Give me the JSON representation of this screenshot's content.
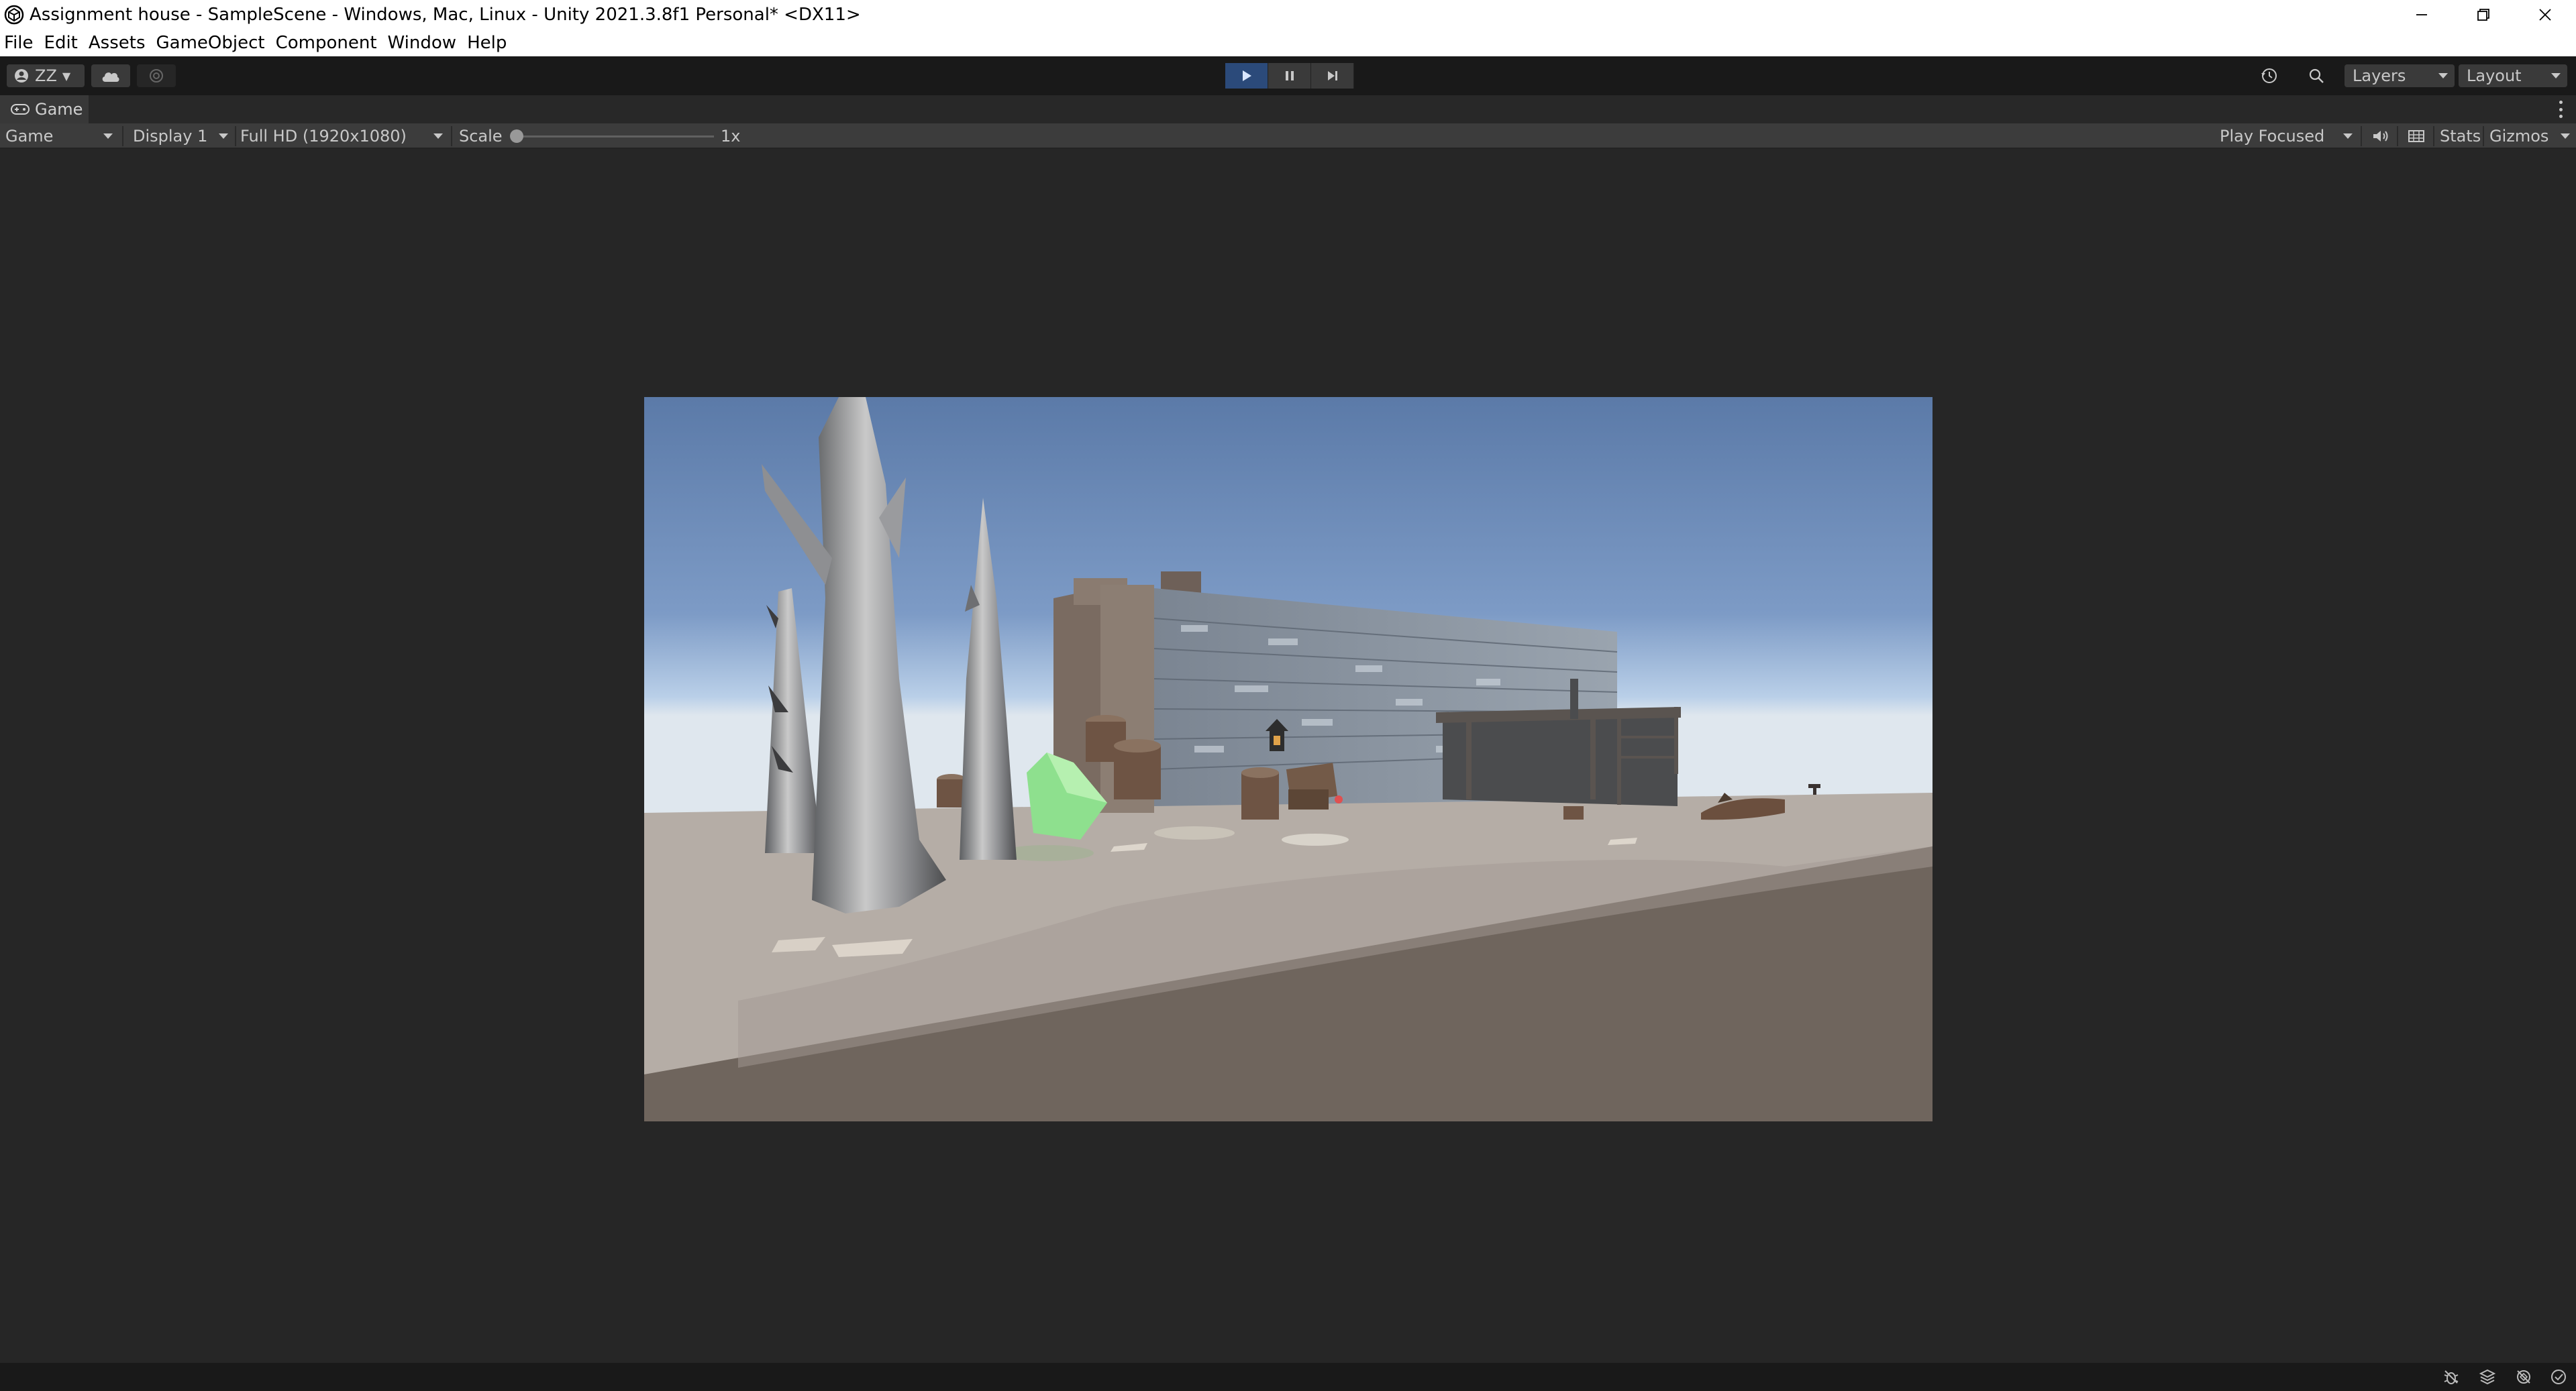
{
  "window": {
    "title": "Assignment house - SampleScene - Windows, Mac, Linux - Unity 2021.3.8f1 Personal* <DX11>"
  },
  "menu": [
    "File",
    "Edit",
    "Assets",
    "GameObject",
    "Component",
    "Window",
    "Help"
  ],
  "toolbar": {
    "account_label": "ZZ",
    "layers_label": "Layers",
    "layout_label": "Layout"
  },
  "tab": {
    "label": "Game"
  },
  "game_bar": {
    "mode": "Game",
    "display": "Display 1",
    "resolution": "Full HD (1920x1080)",
    "scale_label": "Scale",
    "scale_value": "1x",
    "play_mode": "Play Focused",
    "stats_label": "Stats",
    "gizmos_label": "Gizmos"
  },
  "play_state": {
    "playing": true
  },
  "colors": {
    "accent_play": "#2b4a7a",
    "editor_bg": "#262626",
    "sky_top": "#5b7aa8",
    "sky_horizon": "#bcd2ea",
    "ground": "#a79f98",
    "ground_shadow": "#6f655d"
  },
  "icons": [
    "unity-logo-icon",
    "minimize-icon",
    "restore-icon",
    "close-icon",
    "account-icon",
    "cloud-icon",
    "collab-icon",
    "play-icon",
    "pause-icon",
    "step-icon",
    "history-icon",
    "search-icon",
    "gamepad-icon",
    "audio-icon",
    "aspect-icon",
    "bug-icon",
    "stack-icon",
    "network-icon",
    "check-icon"
  ]
}
